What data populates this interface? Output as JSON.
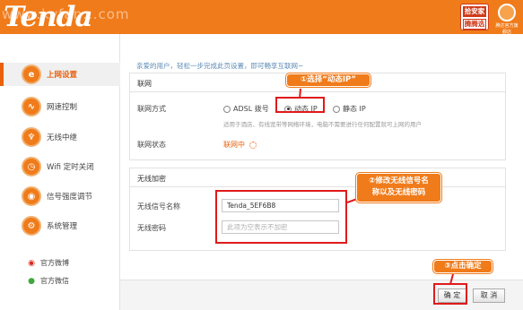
{
  "header": {
    "logo": "Tenda",
    "watermark": "www.kyfan...com",
    "badge": [
      "拾安家",
      "腾腾选"
    ],
    "mini_logo_caption": "腾达官方旗舰店"
  },
  "sidebar": {
    "items": [
      {
        "label": "上网设置",
        "icon": "e"
      },
      {
        "label": "网速控制",
        "icon": "∿"
      },
      {
        "label": "无线中继",
        "icon": "♆"
      },
      {
        "label": "Wifi 定时关闭",
        "icon": "◷"
      },
      {
        "label": "信号强度调节",
        "icon": "◉"
      },
      {
        "label": "系统管理",
        "icon": "⚙"
      }
    ],
    "social": [
      {
        "label": "官方微博",
        "icon": "weibo-icon"
      },
      {
        "label": "官方微信",
        "icon": "wechat-icon"
      }
    ]
  },
  "main": {
    "intro": "亲爱的用户，轻松一步完成此页设置，即可畅享互联网~",
    "connect": {
      "title": "联网",
      "mode_label": "联网方式",
      "options": [
        "ADSL 拨号",
        "动态 IP",
        "静态 IP"
      ],
      "selected": "动态 IP",
      "hint": "适用于酒店、有线宽带等网络环境，电脑不需要进行任何配置就可上网的用户",
      "status_label": "联网状态",
      "status_value": "联网中"
    },
    "wireless": {
      "title": "无线加密",
      "ssid_label": "无线信号名称",
      "ssid_value": "Tenda_5EF6B8",
      "password_label": "无线密码",
      "password_placeholder": "此项为空表示不加密"
    }
  },
  "annotations": {
    "step1": "①选择“动态IP”",
    "step2": [
      "②修改无线信号名",
      "称以及无线密码"
    ],
    "step3": "③点击确定"
  },
  "footer": {
    "ok": "确 定",
    "cancel": "取 消"
  },
  "colors": {
    "brand_orange": "#f07b1a",
    "annotation_red": "#e01a1a",
    "status_orange": "#e8610e"
  }
}
